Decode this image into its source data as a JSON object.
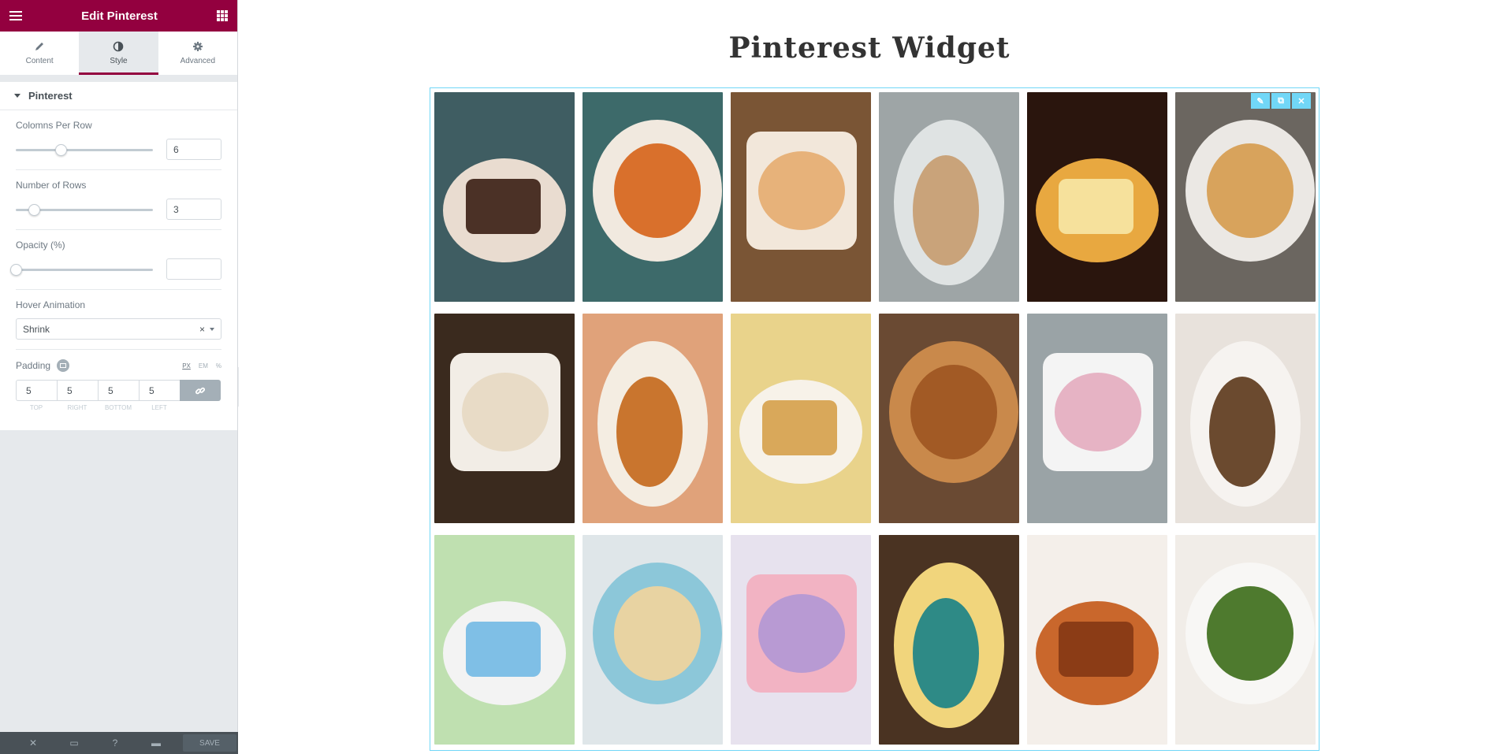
{
  "panel": {
    "title": "Edit Pinterest",
    "tabs": [
      {
        "label": "Content",
        "icon": "pencil-icon"
      },
      {
        "label": "Style",
        "icon": "half-circle-icon"
      },
      {
        "label": "Advanced",
        "icon": "gear-icon"
      }
    ],
    "section": "Pinterest",
    "controls": {
      "columns": {
        "label": "Colomns Per Row",
        "value": "6",
        "level": 0.33
      },
      "rows": {
        "label": "Number of Rows",
        "value": "3",
        "level": 0.13
      },
      "opacity": {
        "label": "Opacity (%)",
        "value": "",
        "level": 0
      },
      "hover": {
        "label": "Hover Animation",
        "value": "Shrink"
      },
      "padding": {
        "label": "Padding",
        "units": [
          "PX",
          "EM",
          "%"
        ],
        "values": [
          "5",
          "5",
          "5",
          "5"
        ],
        "sides": [
          "TOP",
          "RIGHT",
          "BOTTOM",
          "LEFT"
        ]
      }
    },
    "footer": {
      "save": "SAVE"
    }
  },
  "canvas": {
    "title": "Pinterest Widget",
    "photos": [
      {
        "name": "photo-rye-sandwich",
        "bg": "#3f5d62",
        "a": "#e9dcd0",
        "b": "#4b3126"
      },
      {
        "name": "photo-shrimp-grits",
        "bg": "#3d6a6a",
        "a": "#f1e9df",
        "b": "#d9702c"
      },
      {
        "name": "photo-cheese-dip",
        "bg": "#7a5535",
        "a": "#f2e7da",
        "b": "#e7b27a"
      },
      {
        "name": "photo-pork-chops",
        "bg": "#9ea5a6",
        "a": "#dfe3e3",
        "b": "#c9a37a"
      },
      {
        "name": "photo-buttermilk-pie",
        "bg": "#2a150d",
        "a": "#e8a840",
        "b": "#f6e19c"
      },
      {
        "name": "photo-omelet-plate",
        "bg": "#6b6660",
        "a": "#ebe8e4",
        "b": "#d8a35c"
      },
      {
        "name": "photo-coconut-dessert",
        "bg": "#3a2a1e",
        "a": "#f2ede6",
        "b": "#e8dbc6"
      },
      {
        "name": "photo-pancake-stack",
        "bg": "#e0a27a",
        "a": "#f4ede2",
        "b": "#c9752e"
      },
      {
        "name": "photo-banana-pudding",
        "bg": "#e9d38b",
        "a": "#f7f2e9",
        "b": "#d9a85a"
      },
      {
        "name": "photo-fried-shrimp",
        "bg": "#6a4a33",
        "a": "#c9894b",
        "b": "#a25a25"
      },
      {
        "name": "photo-bunny-cupcakes",
        "bg": "#9aa3a6",
        "a": "#f4f4f4",
        "b": "#e6b3c4"
      },
      {
        "name": "photo-carrot-cake",
        "bg": "#e8e2dc",
        "a": "#f6f3f0",
        "b": "#6b4a2f"
      },
      {
        "name": "photo-cotton-candy-cones",
        "bg": "#bfe0b0",
        "a": "#f3f3f3",
        "b": "#7fbfe6"
      },
      {
        "name": "photo-coconut-cookies",
        "bg": "#dfe6e9",
        "a": "#8cc7d9",
        "b": "#e8d3a2"
      },
      {
        "name": "photo-bunny-marshmallows",
        "bg": "#e7e2ee",
        "a": "#f2b3c3",
        "b": "#b89ad3"
      },
      {
        "name": "photo-lemon-bars",
        "bg": "#4a3322",
        "a": "#f1d57c",
        "b": "#2e8a86"
      },
      {
        "name": "photo-sweet-potato-fries",
        "bg": "#f4efea",
        "a": "#c9672c",
        "b": "#8b3c16"
      },
      {
        "name": "photo-green-beans",
        "bg": "#f1ede8",
        "a": "#f8f7f5",
        "b": "#4e7a2e"
      }
    ]
  }
}
